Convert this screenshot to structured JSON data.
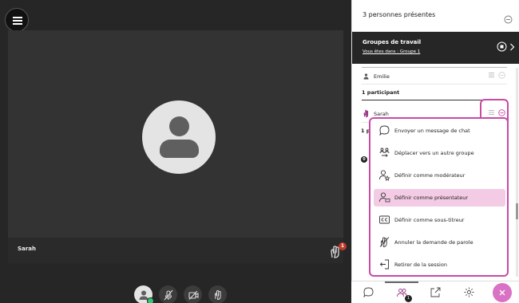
{
  "panel": {
    "title": "3 personnes présentes",
    "groups": {
      "title": "Groupes de travail",
      "subtitle": "Vous êtes dans : Groupe 1"
    },
    "participant_one": "Emilie",
    "section_label": "1 participant",
    "participant_two": "Sarah",
    "fragment_a": "1 p",
    "fragment_b": "0"
  },
  "video": {
    "caption": "Sarah",
    "raise_hand_count": "1"
  },
  "context_menu": {
    "items": [
      {
        "label": "Envoyer un message de chat",
        "icon": "chat-bubble-icon"
      },
      {
        "label": "Déplacer vers un autre groupe",
        "icon": "move-group-icon"
      },
      {
        "label": "Définir comme modérateur",
        "icon": "moderator-icon"
      },
      {
        "label": "Définir comme présentateur",
        "icon": "presenter-icon"
      },
      {
        "label": "Définir comme sous-titreur",
        "icon": "captions-icon"
      },
      {
        "label": "Annuler la demande de parole",
        "icon": "cancel-hand-icon"
      },
      {
        "label": "Retirer de la session",
        "icon": "remove-session-icon"
      }
    ]
  },
  "tabs": {
    "participants_badge": "1"
  },
  "colors": {
    "highlight": "#c84aa5",
    "active_item": "#f3cbe4",
    "close_button": "#d972c4",
    "stage_bg": "#262626"
  }
}
